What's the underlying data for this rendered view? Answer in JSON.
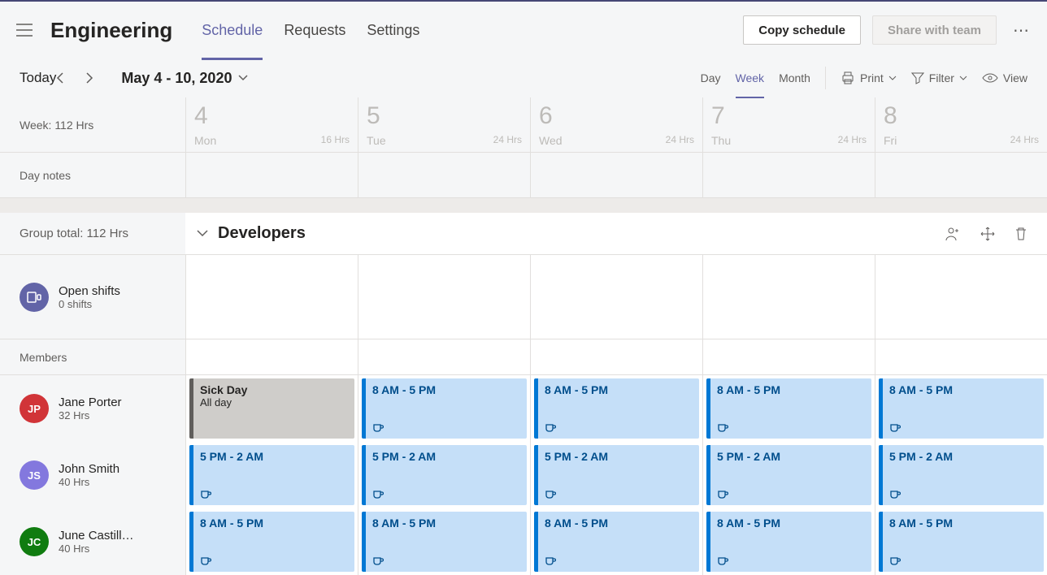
{
  "team_title": "Engineering",
  "tabs": {
    "schedule": "Schedule",
    "requests": "Requests",
    "settings": "Settings"
  },
  "buttons": {
    "copy": "Copy schedule",
    "share": "Share with team"
  },
  "today": "Today",
  "date_range": "May 4 - 10, 2020",
  "view_range": {
    "day": "Day",
    "week": "Week",
    "month": "Month"
  },
  "tools": {
    "print": "Print",
    "filter": "Filter",
    "view": "View"
  },
  "week_total": "Week: 112 Hrs",
  "day_notes": "Day notes",
  "days": [
    {
      "num": "4",
      "dow": "Mon",
      "hrs": "16 Hrs"
    },
    {
      "num": "5",
      "dow": "Tue",
      "hrs": "24 Hrs"
    },
    {
      "num": "6",
      "dow": "Wed",
      "hrs": "24 Hrs"
    },
    {
      "num": "7",
      "dow": "Thu",
      "hrs": "24 Hrs"
    },
    {
      "num": "8",
      "dow": "Fri",
      "hrs": "24 Hrs"
    }
  ],
  "group_total": "Group total: 112 Hrs",
  "group_name": "Developers",
  "open_shifts": {
    "title": "Open shifts",
    "count": "0 shifts"
  },
  "members_label": "Members",
  "members": [
    {
      "initials": "JP",
      "name": "Jane Porter",
      "hrs": "32 Hrs",
      "color": "red",
      "shifts": [
        {
          "type": "gray",
          "label": "Sick Day",
          "sub": "All day",
          "break": false
        },
        {
          "type": "blue",
          "label": "8 AM - 5 PM",
          "break": true
        },
        {
          "type": "blue",
          "label": "8 AM - 5 PM",
          "break": true
        },
        {
          "type": "blue",
          "label": "8 AM - 5 PM",
          "break": true
        },
        {
          "type": "blue",
          "label": "8 AM - 5 PM",
          "break": true
        }
      ]
    },
    {
      "initials": "JS",
      "name": "John Smith",
      "hrs": "40 Hrs",
      "color": "purple",
      "shifts": [
        {
          "type": "blue",
          "label": "5 PM - 2 AM",
          "break": true
        },
        {
          "type": "blue",
          "label": "5 PM - 2 AM",
          "break": true
        },
        {
          "type": "blue",
          "label": "5 PM - 2 AM",
          "break": true
        },
        {
          "type": "blue",
          "label": "5 PM - 2 AM",
          "break": true
        },
        {
          "type": "blue",
          "label": "5 PM - 2 AM",
          "break": true
        }
      ]
    },
    {
      "initials": "JC",
      "name": "June Castill…",
      "hrs": "40 Hrs",
      "color": "green",
      "shifts": [
        {
          "type": "blue",
          "label": "8 AM - 5 PM",
          "break": true
        },
        {
          "type": "blue",
          "label": "8 AM - 5 PM",
          "break": true
        },
        {
          "type": "blue",
          "label": "8 AM - 5 PM",
          "break": true
        },
        {
          "type": "blue",
          "label": "8 AM - 5 PM",
          "break": true
        },
        {
          "type": "blue",
          "label": "8 AM - 5 PM",
          "break": true
        }
      ]
    }
  ]
}
